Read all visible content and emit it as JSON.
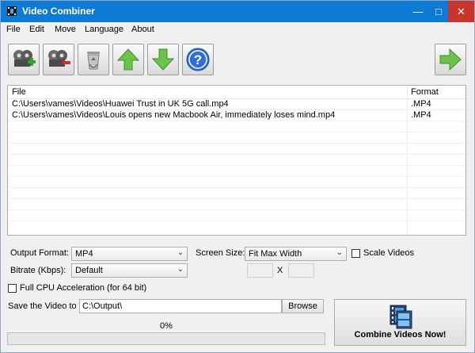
{
  "window": {
    "title": "Video Combiner"
  },
  "menu": [
    "File",
    "Edit",
    "Move",
    "Language",
    "About"
  ],
  "toolbar": {
    "buttons": [
      {
        "name": "add-video",
        "icon": "film-add-icon"
      },
      {
        "name": "remove-video",
        "icon": "film-remove-icon"
      },
      {
        "name": "clear-list",
        "icon": "recycle-bin-icon"
      },
      {
        "name": "move-up",
        "icon": "arrow-up-icon"
      },
      {
        "name": "move-down",
        "icon": "arrow-down-icon"
      },
      {
        "name": "help",
        "icon": "help-icon"
      },
      {
        "name": "next",
        "icon": "arrow-right-icon"
      }
    ]
  },
  "file_list": {
    "columns": [
      "File",
      "Format"
    ],
    "rows": [
      {
        "file": "C:\\Users\\vames\\Videos\\Huawei  Trust in UK 5G call.mp4",
        "format": ".MP4"
      },
      {
        "file": "C:\\Users\\vames\\Videos\\Louis opens new Macbook Air, immediately loses mind.mp4",
        "format": ".MP4"
      }
    ]
  },
  "settings": {
    "output_format_label": "Output Format:",
    "output_format_value": "MP4",
    "screen_size_label": "Screen Size:",
    "screen_size_value": "Fit Max Width",
    "scale_videos_label": "Scale Videos",
    "bitrate_label": "Bitrate (Kbps):",
    "bitrate_value": "Default",
    "size_separator": "X",
    "full_cpu_label": "Full CPU Acceleration (for 64 bit)"
  },
  "save": {
    "label": "Save the Video to",
    "path": "C:\\Output\\",
    "browse_label": "Browse"
  },
  "progress": {
    "percent_text": "0%",
    "value": 0
  },
  "combine_button_label": "Combine Videos Now!",
  "colors": {
    "titlebar": "#0d7bd4",
    "close_button": "#c8352a",
    "progress_fill": "#06b025"
  }
}
